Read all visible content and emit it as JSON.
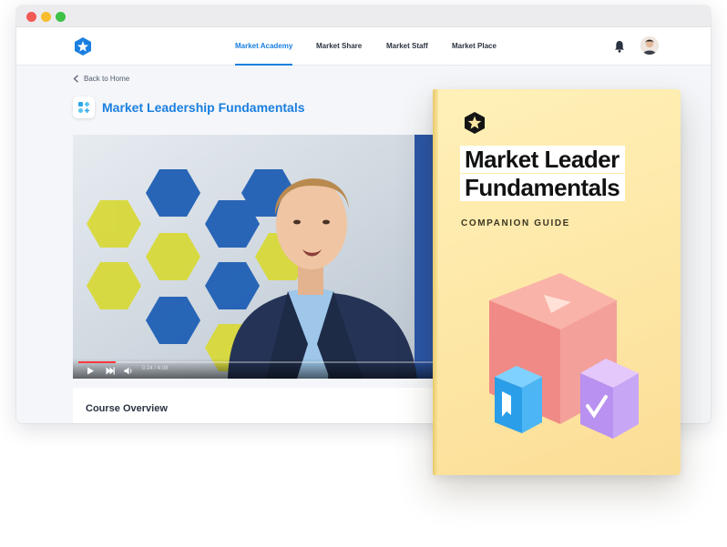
{
  "window": {
    "controls": [
      "close",
      "minimize",
      "maximize"
    ]
  },
  "nav": {
    "logo_icon": "star-hexagon-logo-icon",
    "items": [
      {
        "label": "Market Academy",
        "active": true
      },
      {
        "label": "Market Share",
        "active": false
      },
      {
        "label": "Market Staff",
        "active": false
      },
      {
        "label": "Market Place",
        "active": false
      }
    ],
    "notification_icon": "bell-icon",
    "accent_color": "#1a7fe0"
  },
  "page": {
    "back_label": "Back to Home",
    "course_title": "Market Leadership Fundamentals"
  },
  "video": {
    "time": "0:24 / 4:08",
    "progress_fraction": 0.1,
    "play_icon": "play-icon",
    "next_icon": "skip-next-icon",
    "volume_icon": "volume-icon"
  },
  "overview": {
    "title": "Course Overview"
  },
  "book": {
    "title_line_1": "Market Leader",
    "title_line_2": "Fundamentals",
    "subtitle": "COMPANION GUIDE",
    "cover_color": "#fde6a4"
  }
}
